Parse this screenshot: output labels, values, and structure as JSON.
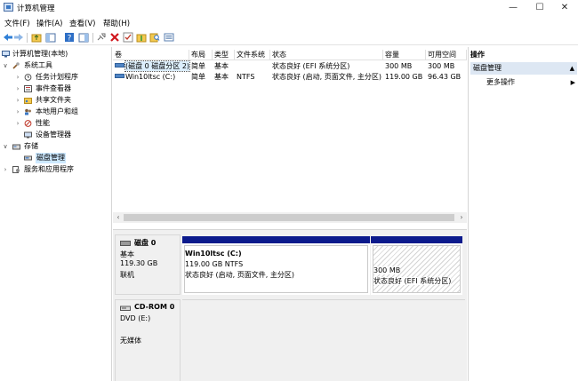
{
  "window": {
    "title": "计算机管理",
    "min": "—",
    "max": "☐",
    "close": "✕"
  },
  "menu": [
    "文件(F)",
    "操作(A)",
    "查看(V)",
    "帮助(H)"
  ],
  "tree": {
    "root": "计算机管理(本地)",
    "system_tools": "系统工具",
    "task_scheduler": "任务计划程序",
    "event_viewer": "事件查看器",
    "shared_folders": "共享文件夹",
    "local_users": "本地用户和组",
    "performance": "性能",
    "device_manager": "设备管理器",
    "storage": "存储",
    "disk_management": "磁盘管理",
    "services": "服务和应用程序"
  },
  "volume_table": {
    "columns": [
      "卷",
      "布局",
      "类型",
      "文件系统",
      "状态",
      "容量",
      "可用空间"
    ],
    "rows": [
      [
        "(磁盘 0 磁盘分区 2)",
        "简单",
        "基本",
        "",
        "状态良好 (EFI 系统分区)",
        "300 MB",
        "300 MB"
      ],
      [
        "Win10ltsc (C:)",
        "简单",
        "基本",
        "NTFS",
        "状态良好 (启动, 页面文件, 主分区)",
        "119.00 GB",
        "96.43 GB"
      ]
    ]
  },
  "disks": [
    {
      "name": "磁盘 0",
      "type": "基本",
      "size": "119.30 GB",
      "status": "联机",
      "partitions": [
        {
          "name": "Win10ltsc  (C:)",
          "size": "119.00 GB NTFS",
          "status": "状态良好 (启动, 页面文件, 主分区)"
        },
        {
          "name": "",
          "size": "300 MB",
          "status": "状态良好 (EFI 系统分区)"
        }
      ]
    },
    {
      "name": "CD-ROM 0",
      "type": "DVD (E:)",
      "status": "无媒体"
    }
  ],
  "actions": {
    "header": "操作",
    "section": "磁盘管理",
    "more": "更多操作"
  }
}
